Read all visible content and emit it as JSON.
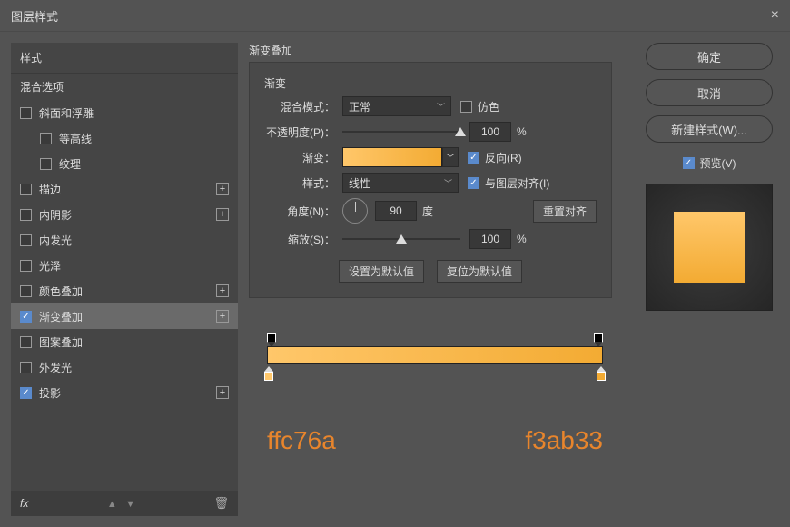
{
  "window": {
    "title": "图层样式"
  },
  "styles_panel": {
    "header": "样式",
    "blend": "混合选项",
    "items": [
      {
        "label": "斜面和浮雕",
        "checked": false,
        "plus": false
      },
      {
        "label": "等高线",
        "checked": false,
        "indent": true
      },
      {
        "label": "纹理",
        "checked": false,
        "indent": true
      },
      {
        "label": "描边",
        "checked": false,
        "plus": true
      },
      {
        "label": "内阴影",
        "checked": false,
        "plus": true
      },
      {
        "label": "内发光",
        "checked": false
      },
      {
        "label": "光泽",
        "checked": false
      },
      {
        "label": "颜色叠加",
        "checked": false,
        "plus": true
      },
      {
        "label": "渐变叠加",
        "checked": true,
        "plus": true,
        "selected": true
      },
      {
        "label": "图案叠加",
        "checked": false
      },
      {
        "label": "外发光",
        "checked": false
      },
      {
        "label": "投影",
        "checked": true,
        "plus": true
      }
    ],
    "fx": "fx"
  },
  "gradient": {
    "section_title": "渐变叠加",
    "subsection": "渐变",
    "blend_mode_label": "混合模式：",
    "blend_mode_value": "正常",
    "dither_label": "仿色",
    "opacity_label": "不透明度(P)：",
    "opacity_value": "100",
    "percent": "%",
    "gradient_label": "渐变：",
    "reverse_label": "反向(R)",
    "style_label": "样式：",
    "style_value": "线性",
    "align_label": "与图层对齐(I)",
    "angle_label": "角度(N)：",
    "angle_value": "90",
    "degree": "度",
    "reset_align": "重置对齐",
    "scale_label": "缩放(S)：",
    "scale_value": "100",
    "set_default": "设置为默认值",
    "reset_default": "复位为默认值"
  },
  "gradient_stops": {
    "left_hex": "ffc76a",
    "right_hex": "f3ab33"
  },
  "right": {
    "ok": "确定",
    "cancel": "取消",
    "new_style": "新建样式(W)...",
    "preview": "预览(V)"
  }
}
